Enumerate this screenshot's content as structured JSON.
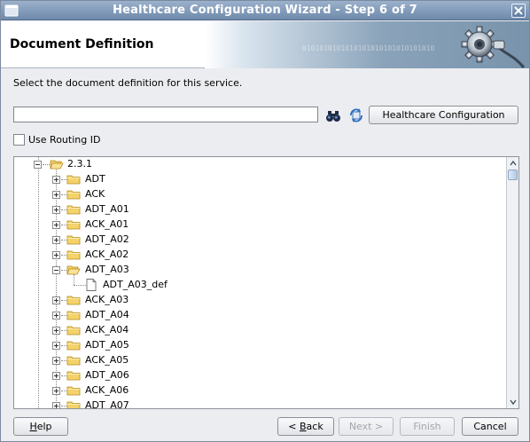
{
  "window": {
    "title": "Healthcare Configuration Wizard - Step 6 of 7"
  },
  "header": {
    "title": "Document Definition",
    "binary_text": "0101010101010101010101010101010"
  },
  "instruction": "Select the document definition for this service.",
  "search": {
    "value": "",
    "config_button": "Healthcare Configuration"
  },
  "routing": {
    "label": "Use Routing ID",
    "checked": false
  },
  "tree": {
    "root": {
      "label": "2.3.1",
      "expanded": true
    },
    "items": [
      {
        "label": "ADT",
        "expanded": false
      },
      {
        "label": "ACK",
        "expanded": false
      },
      {
        "label": "ADT_A01",
        "expanded": false
      },
      {
        "label": "ACK_A01",
        "expanded": false
      },
      {
        "label": "ADT_A02",
        "expanded": false
      },
      {
        "label": "ACK_A02",
        "expanded": false
      },
      {
        "label": "ADT_A03",
        "expanded": true,
        "child": "ADT_A03_def"
      },
      {
        "label": "ACK_A03",
        "expanded": false
      },
      {
        "label": "ADT_A04",
        "expanded": false
      },
      {
        "label": "ACK_A04",
        "expanded": false
      },
      {
        "label": "ADT_A05",
        "expanded": false
      },
      {
        "label": "ACK_A05",
        "expanded": false
      },
      {
        "label": "ADT_A06",
        "expanded": false
      },
      {
        "label": "ACK_A06",
        "expanded": false
      },
      {
        "label": "ADT_A07",
        "expanded": false
      }
    ]
  },
  "buttons": {
    "help": {
      "mn": "H",
      "rest": "elp"
    },
    "back": {
      "pre": "< ",
      "mn": "B",
      "rest": "ack"
    },
    "next": "Next >",
    "finish": "Finish",
    "cancel": "Cancel"
  },
  "colors": {
    "folder": "#f4d36b",
    "folder_edge": "#b48a1c",
    "title_bar": "#7e98b8"
  }
}
